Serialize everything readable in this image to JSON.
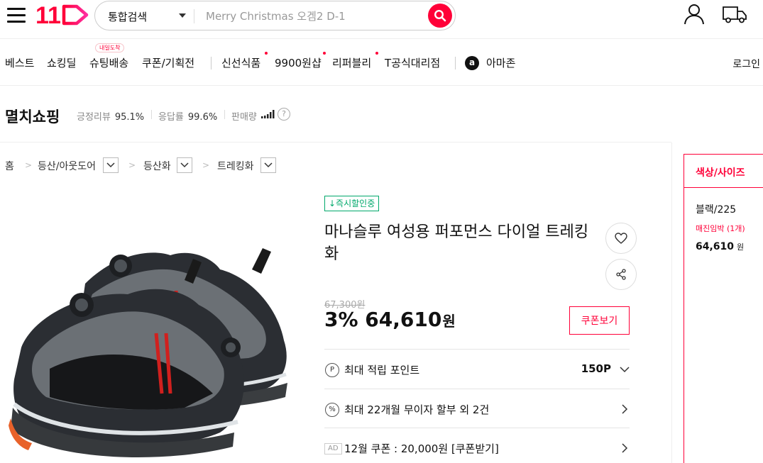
{
  "header": {
    "logo_text": "11",
    "search": {
      "category": "통합검색",
      "placeholder": "Merry Christmas 오겜2 D-1"
    }
  },
  "nav": {
    "items": [
      "베스트",
      "쇼킹딜",
      "슈팅배송",
      "쿠폰/기획전",
      "신선식품",
      "9900원샵",
      "리퍼블리",
      "T공식대리점",
      "아마존"
    ],
    "badge": "내일도착",
    "amazon_mark": "a",
    "login": "로그인"
  },
  "seller": {
    "name": "멸치쇼핑",
    "review_label": "긍정리뷰",
    "review_value": "95.1%",
    "response_label": "응답률",
    "response_value": "99.6%",
    "sales_label": "판매량",
    "help": "?"
  },
  "breadcrumb": {
    "home": "홈",
    "levels": [
      "등산/아웃도어",
      "등산화",
      "트레킹화"
    ]
  },
  "product": {
    "badge": "↓즉시할인중",
    "title": "마나슬루 여성용 퍼포먼스 다이얼 트레킹화",
    "original_price": "67,300원",
    "discount": "3%",
    "sale_price": "64,610",
    "currency": "원",
    "coupon_button": "쿠폰보기",
    "benefits": [
      {
        "icon": "P",
        "text": "최대 적립 포인트",
        "value": "150P"
      },
      {
        "icon": "%",
        "text": "최대 22개월 무이자 할부 외 2건",
        "value": ""
      },
      {
        "icon": "AD",
        "text": "12월 쿠폰 : 20,000원 [쿠폰받기]",
        "value": ""
      }
    ]
  },
  "option_panel": {
    "header": "색상/사이즈",
    "option_name": "블랙/225",
    "stock": "매진임박 (1개)",
    "price": "64,610",
    "currency": "원"
  },
  "colors": {
    "brand": "#ff0038",
    "instant_green": "#00a86b"
  }
}
